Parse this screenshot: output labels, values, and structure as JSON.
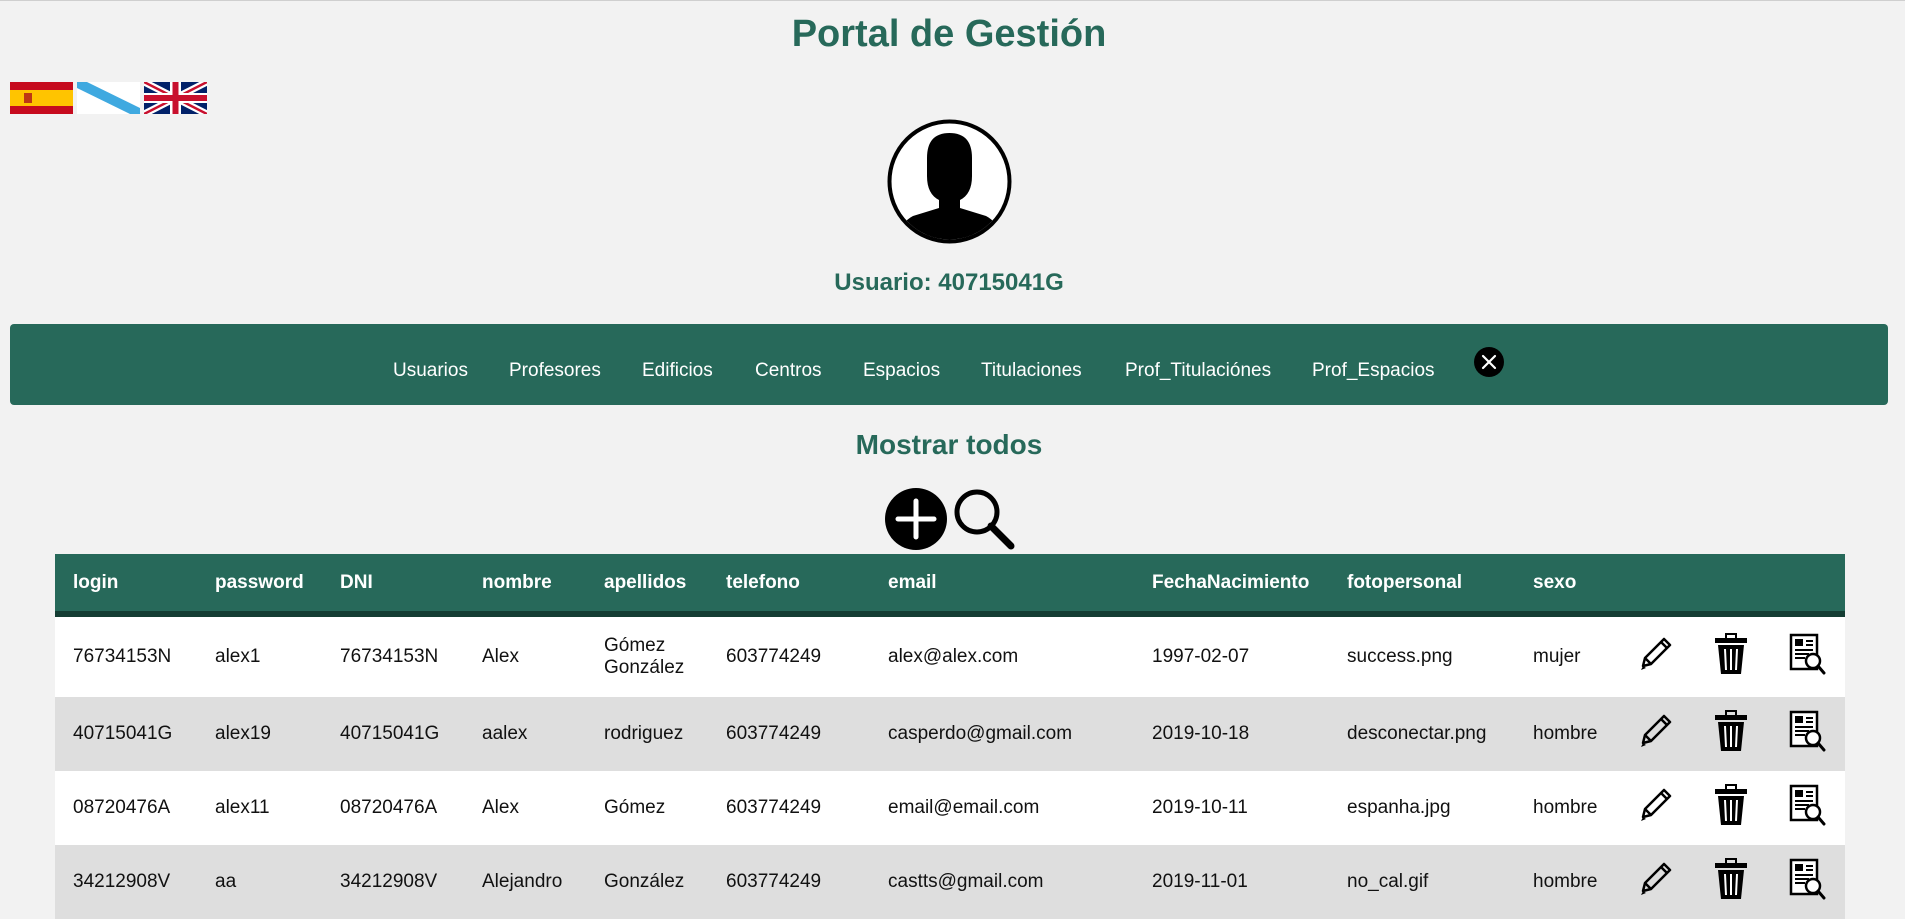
{
  "header": {
    "title": "Portal de Gestión",
    "user_line": "Usuario: 40715041G"
  },
  "languages": [
    {
      "name": "spain-flag-icon"
    },
    {
      "name": "galicia-flag-icon"
    },
    {
      "name": "uk-flag-icon"
    }
  ],
  "nav": {
    "items": [
      "Usuarios",
      "Profesores",
      "Edificios",
      "Centros",
      "Espacios",
      "Titulaciones",
      "Prof_Titulaciónes",
      "Prof_Espacios"
    ],
    "logout_icon": "close-circle-icon"
  },
  "section": {
    "title": "Mostrar todos",
    "add_icon": "add-circle-icon",
    "search_icon": "search-icon"
  },
  "table": {
    "columns": [
      "login",
      "password",
      "DNI",
      "nombre",
      "apellidos",
      "telefono",
      "email",
      "FechaNacimiento",
      "fotopersonal",
      "sexo"
    ],
    "row_action_icons": [
      "pencil-icon",
      "trash-icon",
      "detail-icon"
    ],
    "rows": [
      [
        "76734153N",
        "alex1",
        "76734153N",
        "Alex",
        "Gómez González",
        "603774249",
        "alex@alex.com",
        "1997-02-07",
        "success.png",
        "mujer"
      ],
      [
        "40715041G",
        "alex19",
        "40715041G",
        "aalex",
        "rodriguez",
        "603774249",
        "casperdo@gmail.com",
        "2019-10-18",
        "desconectar.png",
        "hombre"
      ],
      [
        "08720476A",
        "alex11",
        "08720476A",
        "Alex",
        "Gómez",
        "603774249",
        "email@email.com",
        "2019-10-11",
        "espanha.jpg",
        "hombre"
      ],
      [
        "34212908V",
        "aa",
        "34212908V",
        "Alejandro",
        "González",
        "603774249",
        "castts@gmail.com",
        "2019-11-01",
        "no_cal.gif",
        "hombre"
      ]
    ]
  },
  "colors": {
    "accent": "#27695a",
    "background": "#f2f2f2",
    "row_alt": "#dedede"
  }
}
